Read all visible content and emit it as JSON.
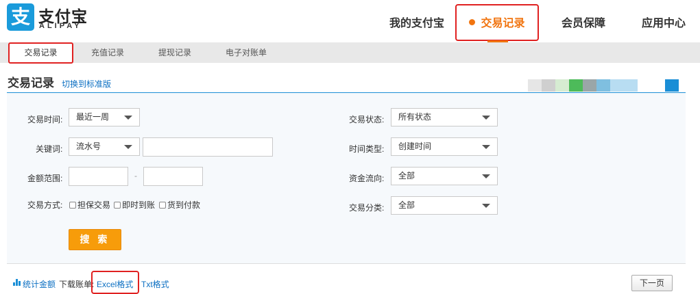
{
  "header": {
    "logo_mark": "支",
    "logo_cn": "支付宝",
    "logo_en": "ALIPAY",
    "nav": {
      "mine": "我的支付宝",
      "trade": "交易记录",
      "vip": "会员保障",
      "app": "应用中心"
    }
  },
  "subnav": {
    "items": [
      "交易记录",
      "充值记录",
      "提现记录",
      "电子对账单"
    ],
    "active_index": 0
  },
  "page": {
    "title": "交易记录",
    "switch_link": "切换到标准版"
  },
  "form": {
    "time_label": "交易时间:",
    "time_value": "最近一周",
    "keyword_label": "关键词:",
    "keyword_type": "流水号",
    "keyword_value": "",
    "amount_label": "金额范围:",
    "amount_min": "",
    "amount_sep": "-",
    "amount_max": "",
    "method_label": "交易方式:",
    "methods": [
      "担保交易",
      "即时到账",
      "货到付款"
    ],
    "status_label": "交易状态:",
    "status_value": "所有状态",
    "timetype_label": "时间类型:",
    "timetype_value": "创建时间",
    "flow_label": "资金流向:",
    "flow_value": "全部",
    "category_label": "交易分类:",
    "category_value": "全部",
    "search_button": "搜 索"
  },
  "footer": {
    "stats": "统计金额",
    "download_label": "下载账单:",
    "excel": "Excel格式",
    "txt": "Txt格式",
    "next_page": "下一页"
  },
  "colors": {
    "accent_orange": "#f1740f",
    "link_blue": "#0b6fc2",
    "highlight_red": "#e02020",
    "button_orange": "#f79c0a",
    "logo_blue": "#1a9bdb"
  }
}
